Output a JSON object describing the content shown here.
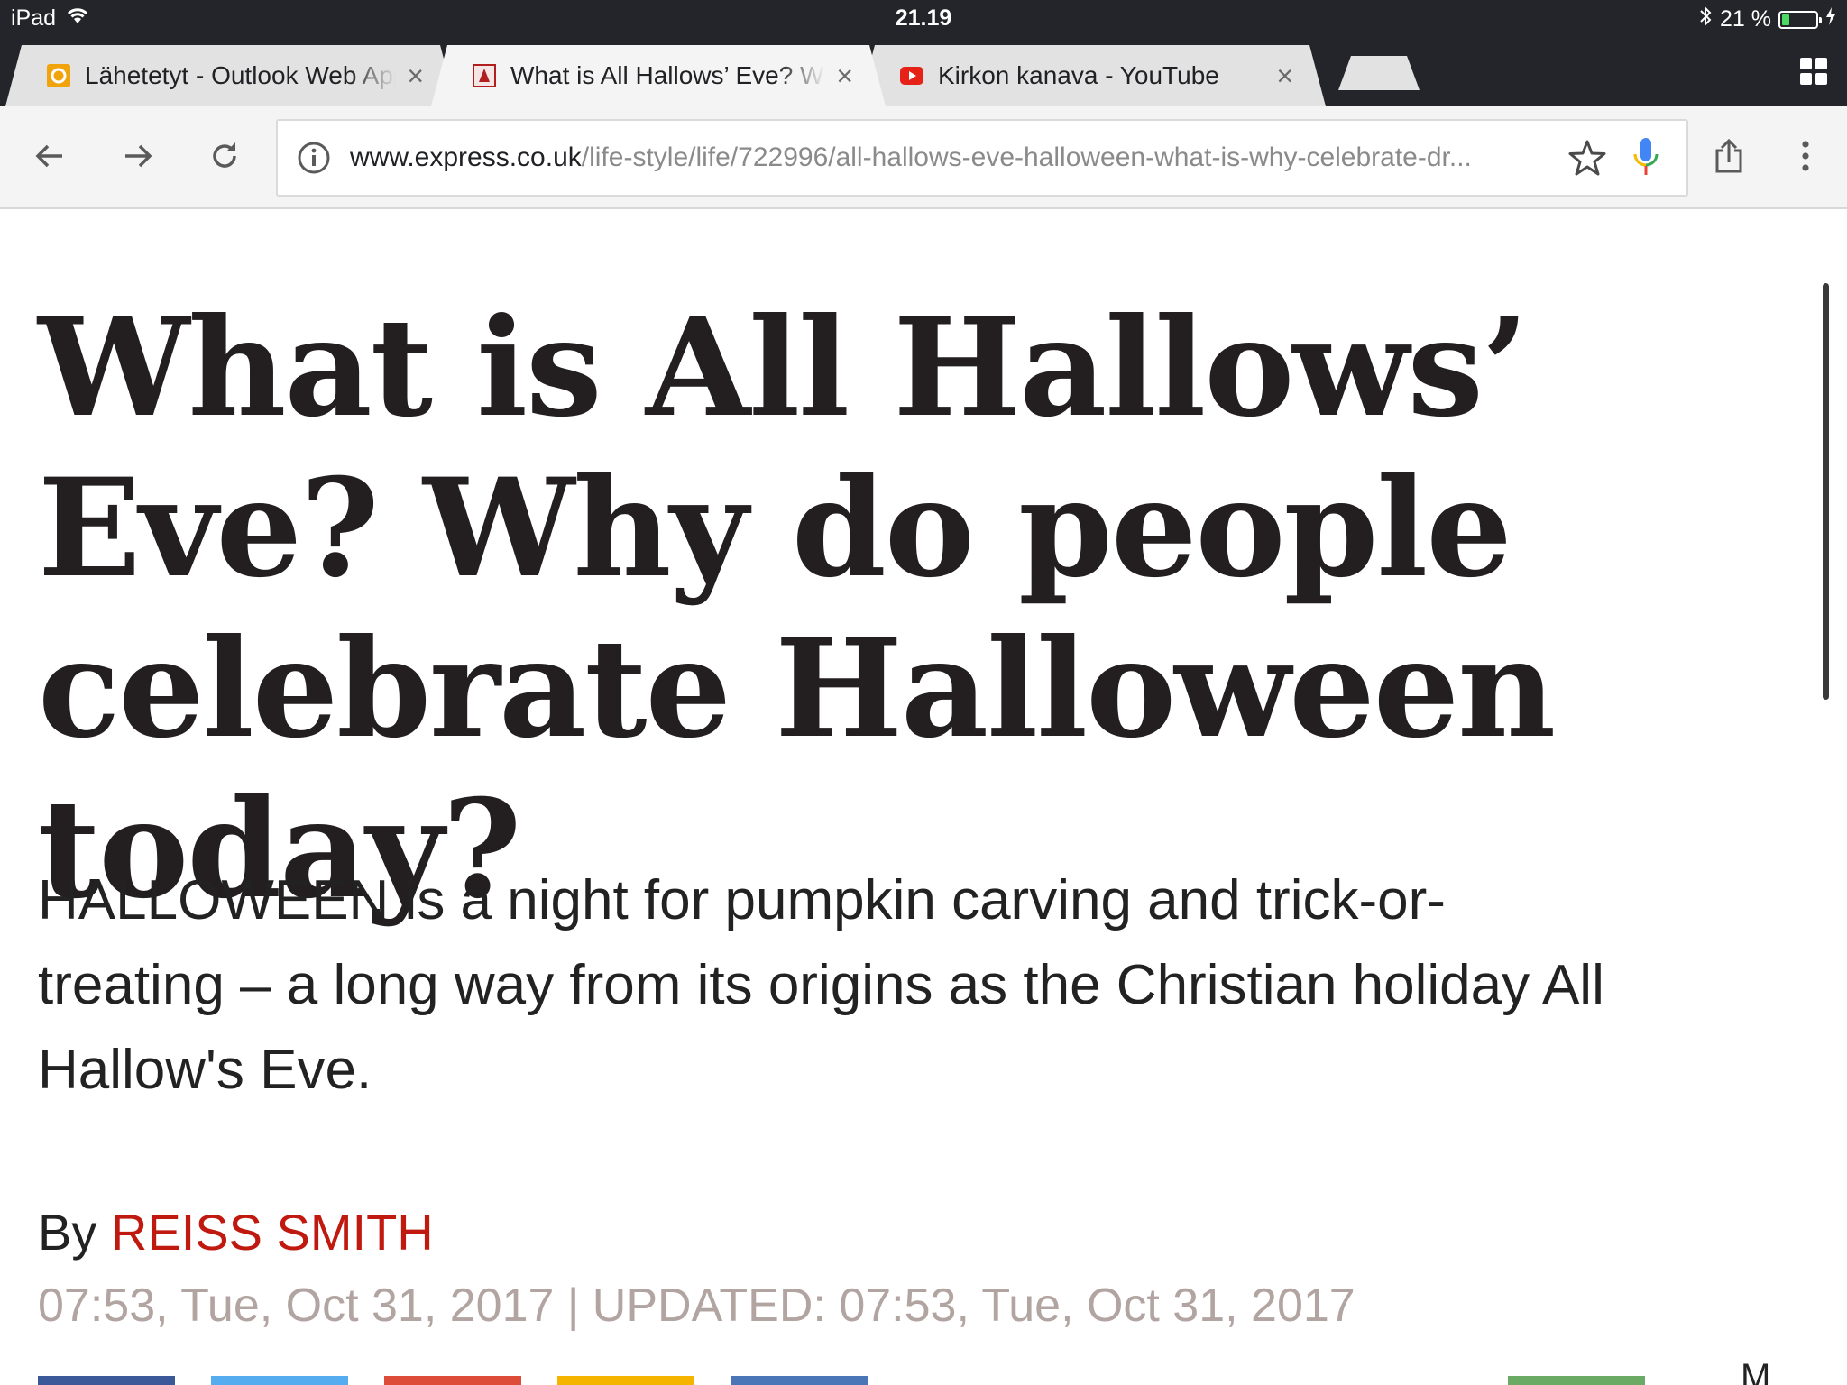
{
  "status_bar": {
    "device": "iPad",
    "time": "21.19",
    "battery_percent": "21 %",
    "battery_level": 0.21
  },
  "tabs": [
    {
      "title": "Lähetetyt - Outlook Web App",
      "icon": "outlook-icon",
      "active": false
    },
    {
      "title": "What is All Hallows’ Eve? Wh",
      "icon": "express-favicon-icon",
      "active": true
    },
    {
      "title": "Kirkon kanava - YouTube",
      "icon": "youtube-icon",
      "active": false
    }
  ],
  "omnibox": {
    "url_domain": "www.express.co.uk",
    "url_path": "/life-style/life/722996/all-hallows-eve-halloween-what-is-why-celebrate-dr..."
  },
  "article": {
    "headline": "What is All Hallows’ Eve? Why do people celebrate Halloween today?",
    "standfirst": "HALLOWEEN is a night for pumpkin carving and trick-or-treating – a long way from its origins as the Christian holiday All Hallow's Eve.",
    "byline_prefix": "By",
    "author": "REISS SMITH",
    "dateline": "07:53, Tue, Oct 31, 2017 | UPDATED: 07:53, Tue, Oct 31, 2017",
    "share_more_glyph": "M"
  },
  "colors": {
    "chrome_dark": "#24252a",
    "tab_inactive": "#e2e2e2",
    "tab_active": "#f4f4f4",
    "author_red": "#c01a10",
    "dateline_gray": "#b2a4a0",
    "share_facebook": "#3b5998",
    "share_twitter": "#55acee",
    "share_google": "#dd4b39",
    "share_email": "#f4b400",
    "share_linkedin": "#4a76b8",
    "share_whatsapp": "#6aaa64"
  }
}
